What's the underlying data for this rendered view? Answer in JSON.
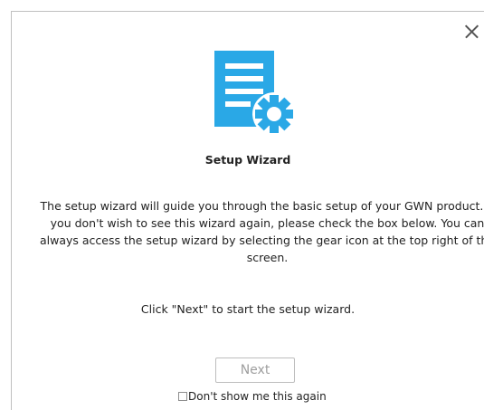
{
  "dialog": {
    "title": "Setup Wizard",
    "description": "The setup wizard will guide you through the basic setup of your GWN product. If you don't wish to see this wizard again, please check the box below. You can always access the setup wizard by selecting the gear icon at the top right of the screen.",
    "hint": "Click \"Next\" to start the setup wizard.",
    "next_label": "Next",
    "dont_show_label": "Don't show me this again",
    "dont_show_checked": false,
    "icon": "document-gear-icon",
    "close_icon": "close-icon"
  },
  "colors": {
    "icon_blue": "#2aa8e6",
    "button_text": "#9e9e9e",
    "border": "#bfbfbf"
  }
}
